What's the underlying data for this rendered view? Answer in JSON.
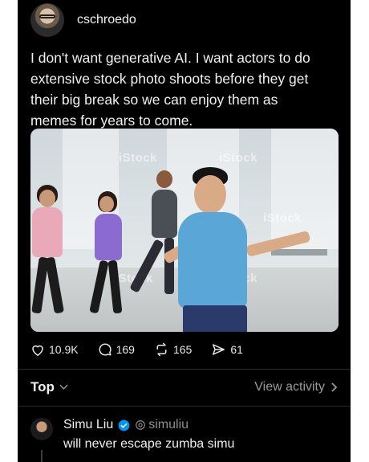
{
  "post": {
    "username": "cschroedo",
    "text": "I don't want generative AI. I want actors to do extensive stock photo shoots before they get their big break so we can enjoy them as memes for years to come.",
    "watermark": "iStock"
  },
  "actions": {
    "likes": "10.9K",
    "comments": "169",
    "reposts": "165",
    "shares": "61"
  },
  "replies_header": {
    "sort_label": "Top",
    "view_activity": "View activity"
  },
  "reply": {
    "name": "Simu Liu",
    "handle": "simuliu",
    "text": "will never escape zumba simu"
  },
  "colors": {
    "background": "#000000",
    "verified": "#0095f6",
    "shirt": "#5aa6d6"
  }
}
